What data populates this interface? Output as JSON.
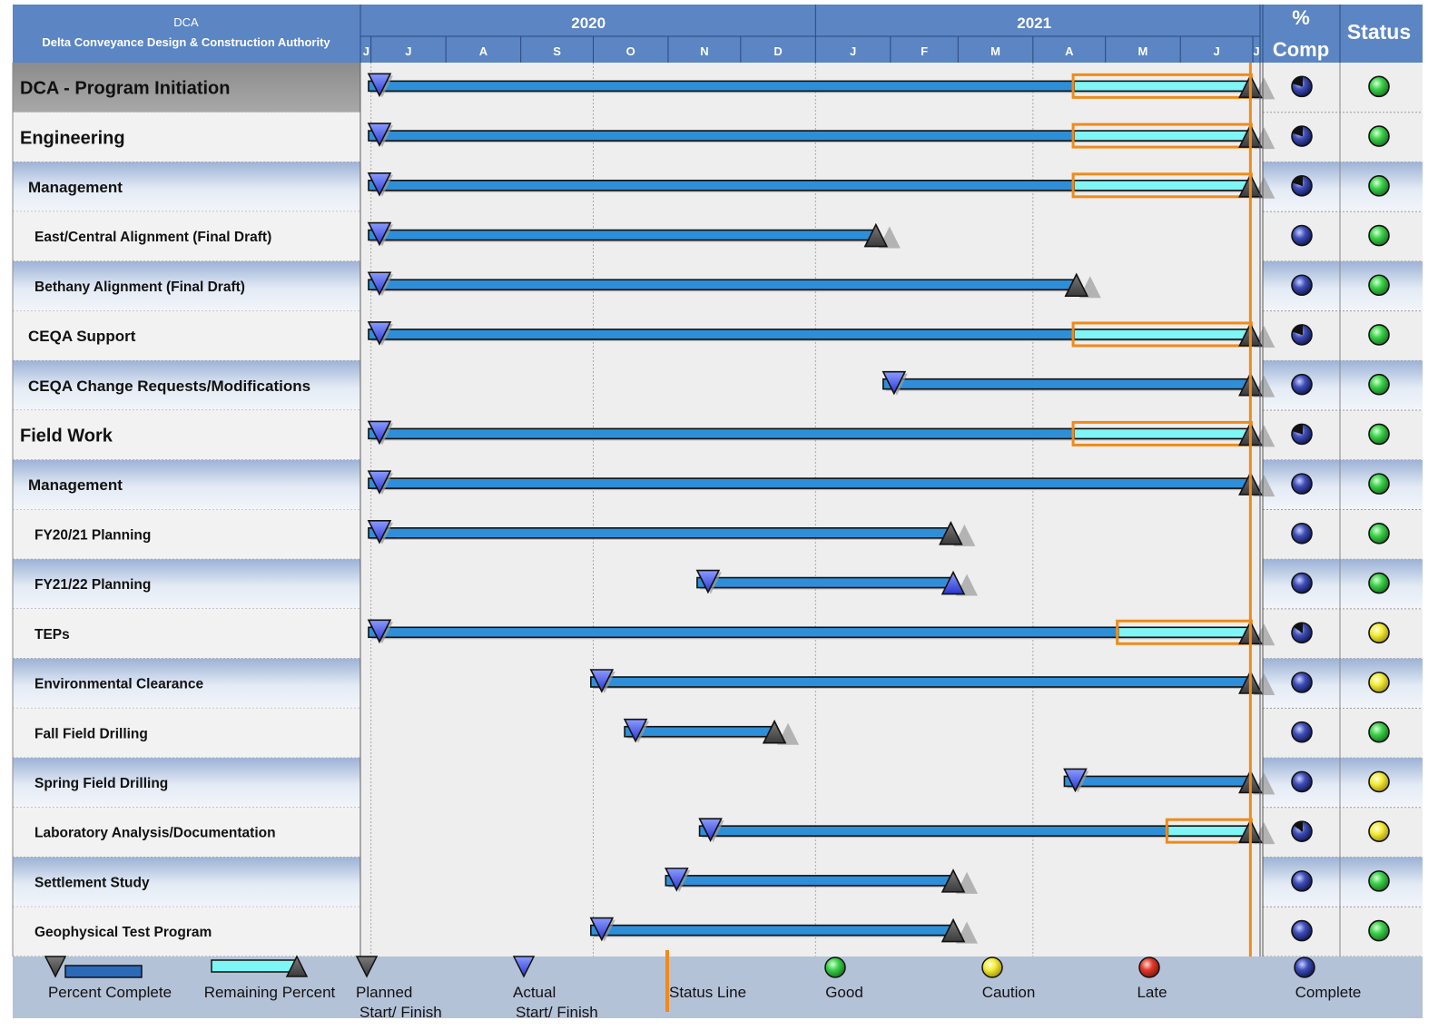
{
  "header": {
    "org_short": "DCA",
    "org_full": "Delta Conveyance Design & Construction Authority",
    "pct_label_line1": "%",
    "pct_label_line2": "Comp",
    "status_label": "Status"
  },
  "colors": {
    "header_blue": "#5b85c3",
    "bar_blue": "#2e8fd8",
    "remaining_cyan": "#7ff5f5",
    "status_line": "#f08a1a",
    "good": "#3cd24a",
    "caution": "#f4ec3a",
    "late": "#e23a2a",
    "complete": "#3f4fb8"
  },
  "chart_data": {
    "type": "gantt",
    "years": [
      {
        "label": "2020",
        "start": "2020-06-01",
        "end": "2021-01-01"
      },
      {
        "label": "2021",
        "start": "2021-01-01",
        "end": "2021-07-01"
      }
    ],
    "months": [
      {
        "label": "J",
        "start": "2020-06-01"
      },
      {
        "label": "J",
        "start": "2020-07-01"
      },
      {
        "label": "A",
        "start": "2020-08-01"
      },
      {
        "label": "S",
        "start": "2020-09-01"
      },
      {
        "label": "O",
        "start": "2020-10-01"
      },
      {
        "label": "N",
        "start": "2020-11-01"
      },
      {
        "label": "D",
        "start": "2020-12-01"
      },
      {
        "label": "J",
        "start": "2021-01-01"
      },
      {
        "label": "F",
        "start": "2021-02-01"
      },
      {
        "label": "M",
        "start": "2021-03-01"
      },
      {
        "label": "A",
        "start": "2021-04-01"
      },
      {
        "label": "M",
        "start": "2021-05-01"
      },
      {
        "label": "J",
        "start": "2021-06-01"
      },
      {
        "label": "J",
        "start": "2021-07-01"
      }
    ],
    "axis_range": [
      "2020-06-27",
      "2021-07-04"
    ],
    "status_date": "2021-06-30",
    "tasks": [
      {
        "name": "DCA - Program Initiation",
        "level": 0,
        "summary": true,
        "start": "2020-06-30",
        "finish": "2021-06-30",
        "percent_complete": 80,
        "status": "good"
      },
      {
        "name": "Engineering",
        "level": 0,
        "start": "2020-06-30",
        "finish": "2021-06-30",
        "percent_complete": 80,
        "status": "good"
      },
      {
        "name": "Management",
        "level": 1,
        "start": "2020-06-30",
        "finish": "2021-06-30",
        "percent_complete": 80,
        "status": "good"
      },
      {
        "name": "East/Central Alignment (Final Draft)",
        "level": 2,
        "start": "2020-06-30",
        "finish": "2021-01-26",
        "percent_complete": 100,
        "status": "good"
      },
      {
        "name": "Bethany Alignment (Final Draft)",
        "level": 2,
        "start": "2020-06-30",
        "finish": "2021-04-19",
        "percent_complete": 100,
        "status": "good"
      },
      {
        "name": "CEQA Support",
        "level": 1,
        "start": "2020-06-30",
        "finish": "2021-06-30",
        "percent_complete": 80,
        "status": "good"
      },
      {
        "name": "CEQA Change Requests/Modifications",
        "level": 1,
        "start": "2021-01-29",
        "finish": "2021-06-30",
        "percent_complete": 100,
        "status": "good"
      },
      {
        "name": "Field Work",
        "level": 0,
        "start": "2020-06-30",
        "finish": "2021-06-30",
        "percent_complete": 80,
        "status": "good"
      },
      {
        "name": "Management",
        "level": 1,
        "start": "2020-06-30",
        "finish": "2021-06-30",
        "percent_complete": 100,
        "status": "good"
      },
      {
        "name": "FY20/21 Planning",
        "level": 2,
        "start": "2020-06-30",
        "finish": "2021-02-26",
        "percent_complete": 100,
        "status": "good"
      },
      {
        "name": "FY21/22 Planning",
        "level": 2,
        "start": "2020-11-13",
        "finish": "2021-02-27",
        "percent_complete": 100,
        "status": "good",
        "finish_actual": true
      },
      {
        "name": "TEPs",
        "level": 2,
        "start": "2020-06-30",
        "finish": "2021-06-30",
        "percent_complete": 85,
        "status": "caution"
      },
      {
        "name": "Environmental Clearance",
        "level": 2,
        "start": "2020-09-30",
        "finish": "2021-06-30",
        "percent_complete": 100,
        "status": "caution"
      },
      {
        "name": "Fall Field Drilling",
        "level": 2,
        "start": "2020-10-14",
        "finish": "2020-12-15",
        "percent_complete": 100,
        "status": "good"
      },
      {
        "name": "Spring Field Drilling",
        "level": 2,
        "start": "2021-04-14",
        "finish": "2021-06-30",
        "percent_complete": 100,
        "status": "caution"
      },
      {
        "name": "Laboratory Analysis/Documentation",
        "level": 2,
        "start": "2020-11-14",
        "finish": "2021-06-30",
        "percent_complete": 85,
        "status": "caution"
      },
      {
        "name": "Settlement Study",
        "level": 2,
        "start": "2020-10-31",
        "finish": "2021-02-27",
        "percent_complete": 100,
        "status": "good"
      },
      {
        "name": "Geophysical Test Program",
        "level": 2,
        "start": "2020-09-30",
        "finish": "2021-02-27",
        "percent_complete": 100,
        "status": "good"
      }
    ]
  },
  "legend": {
    "percent_complete": "Percent Complete",
    "remaining_percent": "Remaining Percent",
    "planned_line1": "Planned",
    "planned_line2": "Start/ Finish",
    "actual_line1": "Actual",
    "actual_line2": "Start/ Finish",
    "status_line": "Status Line",
    "good": "Good",
    "caution": "Caution",
    "late": "Late",
    "complete": "Complete"
  }
}
